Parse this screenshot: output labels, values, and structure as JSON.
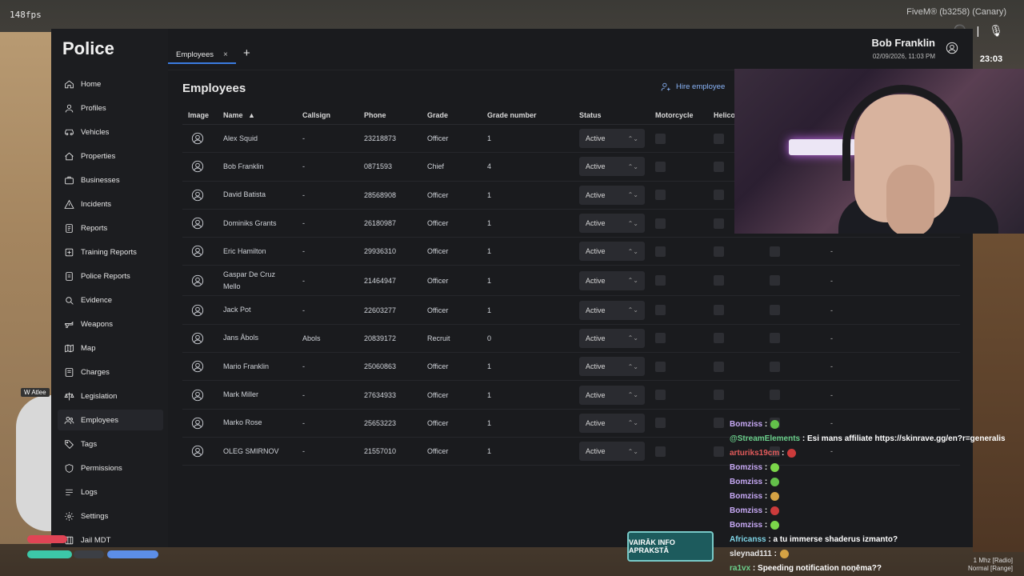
{
  "hud": {
    "fps": "148fps",
    "fivem_build": "FiveM® (b3258) (Canary)",
    "clock": "23:03",
    "radio_freq": "1 Mhz [Radio]",
    "voice_range": "Normal [Range]"
  },
  "app": {
    "title": "Police",
    "user_name": "Bob Franklin",
    "user_datetime": "02/09/2026, 11:03 PM"
  },
  "tabs": [
    {
      "label": "Employees",
      "close": "×"
    }
  ],
  "add_tab": "+",
  "sidebar": {
    "items": [
      {
        "label": "Home",
        "icon": "home-icon"
      },
      {
        "label": "Profiles",
        "icon": "user-icon"
      },
      {
        "label": "Vehicles",
        "icon": "car-icon"
      },
      {
        "label": "Properties",
        "icon": "house-icon"
      },
      {
        "label": "Businesses",
        "icon": "briefcase-icon"
      },
      {
        "label": "Incidents",
        "icon": "alert-icon"
      },
      {
        "label": "Reports",
        "icon": "report-icon"
      },
      {
        "label": "Training Reports",
        "icon": "training-icon"
      },
      {
        "label": "Police Reports",
        "icon": "police-report-icon"
      },
      {
        "label": "Evidence",
        "icon": "search-icon"
      },
      {
        "label": "Weapons",
        "icon": "weapon-icon"
      },
      {
        "label": "Map",
        "icon": "map-icon"
      },
      {
        "label": "Charges",
        "icon": "charges-icon"
      },
      {
        "label": "Legislation",
        "icon": "scale-icon"
      },
      {
        "label": "Employees",
        "icon": "employees-icon"
      },
      {
        "label": "Tags",
        "icon": "tag-icon"
      },
      {
        "label": "Permissions",
        "icon": "shield-icon"
      },
      {
        "label": "Logs",
        "icon": "logs-icon"
      },
      {
        "label": "Settings",
        "icon": "gear-icon"
      },
      {
        "label": "Jail MDT",
        "icon": "jail-icon"
      }
    ]
  },
  "page": {
    "title": "Employees",
    "hire_label": "Hire employee"
  },
  "table": {
    "headers": {
      "image": "Image",
      "name": "Name",
      "sort": "▲",
      "callsign": "Callsign",
      "phone": "Phone",
      "grade": "Grade",
      "grade_number": "Grade number",
      "status": "Status",
      "motorcycle": "Motorcycle",
      "helicopter": "Helico"
    },
    "rows": [
      {
        "name": "Alex Squid",
        "callsign": "-",
        "phone": "23218873",
        "grade": "Officer",
        "grade_number": "1",
        "status": "Active"
      },
      {
        "name": "Bob Franklin",
        "callsign": "-",
        "phone": "0871593",
        "grade": "Chief",
        "grade_number": "4",
        "status": "Active"
      },
      {
        "name": "David Batista",
        "callsign": "-",
        "phone": "28568908",
        "grade": "Officer",
        "grade_number": "1",
        "status": "Active"
      },
      {
        "name": "Dominiks Grants",
        "callsign": "-",
        "phone": "26180987",
        "grade": "Officer",
        "grade_number": "1",
        "status": "Active"
      },
      {
        "name": "Eric Hamilton",
        "callsign": "-",
        "phone": "29936310",
        "grade": "Officer",
        "grade_number": "1",
        "status": "Active"
      },
      {
        "name": "Gaspar De Cruz Mello",
        "callsign": "-",
        "phone": "21464947",
        "grade": "Officer",
        "grade_number": "1",
        "status": "Active"
      },
      {
        "name": "Jack Pot",
        "callsign": "-",
        "phone": "22603277",
        "grade": "Officer",
        "grade_number": "1",
        "status": "Active"
      },
      {
        "name": "Jans Ābols",
        "callsign": "Abols",
        "phone": "20839172",
        "grade": "Recruit",
        "grade_number": "0",
        "status": "Active"
      },
      {
        "name": "Mario Franklin",
        "callsign": "-",
        "phone": "25060863",
        "grade": "Officer",
        "grade_number": "1",
        "status": "Active"
      },
      {
        "name": "Mark Miller",
        "callsign": "-",
        "phone": "27634933",
        "grade": "Officer",
        "grade_number": "1",
        "status": "Active"
      },
      {
        "name": "Marko Rose",
        "callsign": "-",
        "phone": "25653223",
        "grade": "Officer",
        "grade_number": "1",
        "status": "Active"
      },
      {
        "name": "OLEG SMIRNOV",
        "callsign": "-",
        "phone": "21557010",
        "grade": "Officer",
        "grade_number": "1",
        "status": "Active"
      }
    ],
    "trailing_dash": "-"
  },
  "stream": {
    "banner": "VAIRĀK INFO APRAKSTĀ",
    "chat": [
      {
        "user": "Bomziss",
        "sep": " :",
        "text": ""
      },
      {
        "user": "@StreamElements",
        "sep": " :",
        "text": " Esi mans affiliate https://skinrave.gg/en?r=generalis"
      },
      {
        "user": "arturiks19cm",
        "sep": " :",
        "text": ""
      },
      {
        "user": "Bomziss",
        "sep": " :",
        "text": ""
      },
      {
        "user": "Bomziss",
        "sep": " :",
        "text": ""
      },
      {
        "user": "Bomziss",
        "sep": " :",
        "text": ""
      },
      {
        "user": "Bomziss",
        "sep": " :",
        "text": ""
      },
      {
        "user": "Bomziss",
        "sep": " :",
        "text": ""
      },
      {
        "user": "Africanss",
        "sep": " :",
        "text": " a tu immerse shaderus izmanto?"
      },
      {
        "user": "sleynad111",
        "sep": " :",
        "text": ""
      },
      {
        "user": "ra1vx",
        "sep": " :",
        "text": " Speeding notification noņēma??"
      }
    ],
    "cam_tag": "W Atlee"
  },
  "colors": {
    "accent": "#3a7be0",
    "link": "#8ab4f8",
    "panel": "#1a1b1e"
  }
}
